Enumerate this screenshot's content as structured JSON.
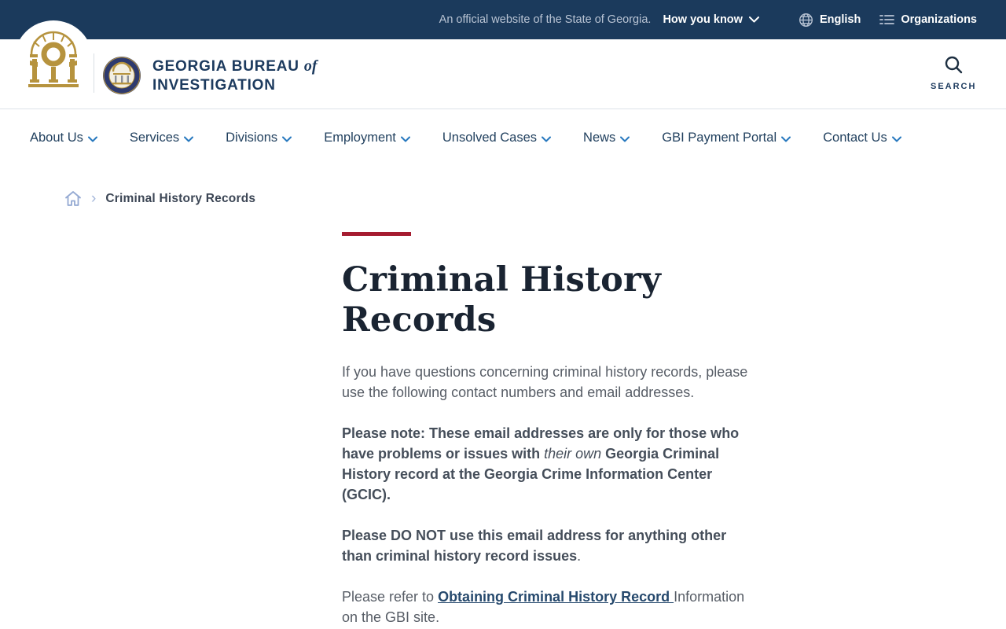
{
  "topbar": {
    "official_text": "An official website of the State of Georgia.",
    "how_you_know_label": "How you know",
    "language_label": "English",
    "organizations_label": "Organizations"
  },
  "header": {
    "brand_line1": "GEORGIA BUREAU",
    "brand_of": "of",
    "brand_line2": "INVESTIGATION",
    "search_label": "SEARCH"
  },
  "nav": {
    "items": [
      {
        "label": "About Us"
      },
      {
        "label": "Services"
      },
      {
        "label": "Divisions"
      },
      {
        "label": "Employment"
      },
      {
        "label": "Unsolved Cases"
      },
      {
        "label": "News"
      },
      {
        "label": "GBI Payment Portal"
      },
      {
        "label": "Contact Us"
      }
    ]
  },
  "breadcrumb": {
    "current": "Criminal History Records"
  },
  "article": {
    "title": "Criminal History Records",
    "p1": "If you have questions concerning criminal history records, please use the following contact numbers and email addresses.",
    "p2": {
      "bold1": "Please note: These email addresses are only for those who have problems or issues with ",
      "italic": "their own",
      "bold2": " Georgia Criminal History record at the Georgia Crime Information Center (GCIC)."
    },
    "p3": {
      "bold": "Please DO NOT use this email address for anything other than criminal history record issues",
      "tail": "."
    },
    "p4": {
      "pre": "Please refer to ",
      "link": "Obtaining Criminal History Record ",
      "post": "Information on the GBI site."
    }
  },
  "colors": {
    "topbar_navy": "#1B3A5C",
    "brand_navy": "#1C3A5E",
    "accent_red": "#A51C30",
    "chevron_blue": "#2778BE",
    "breadcrumb_blue": "#94A9D2",
    "body_gray": "#575D66",
    "link_navy": "#26496D",
    "logo_gold": "#B6933E"
  }
}
